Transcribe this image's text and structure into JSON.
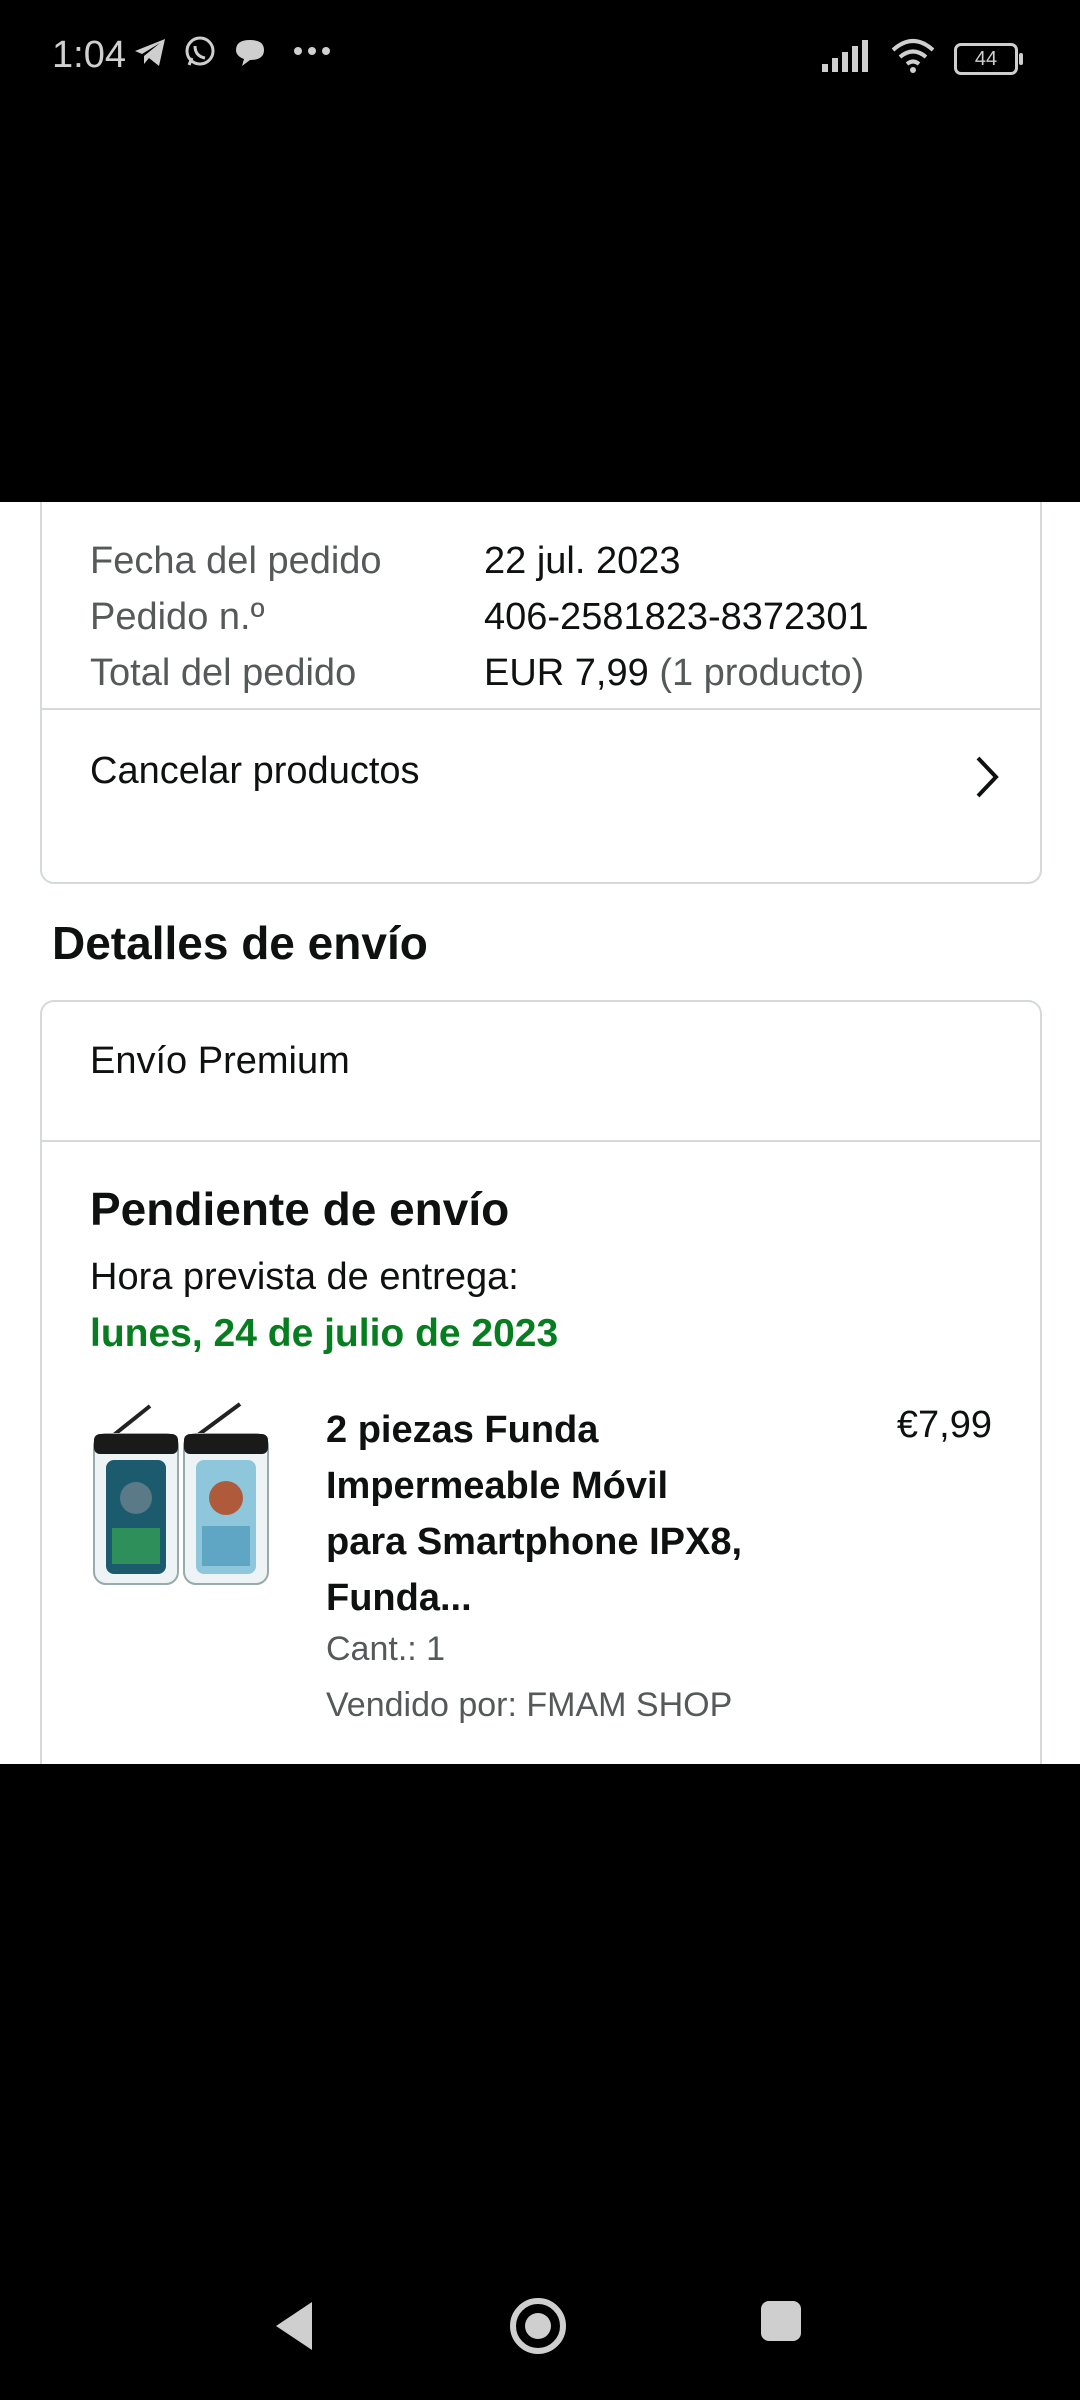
{
  "status_bar": {
    "time": "1:04",
    "battery": "44",
    "icons": [
      "telegram-icon",
      "whatsapp-icon",
      "chat-bubble-icon",
      "more-dots-icon",
      "signal-icon",
      "wifi-icon",
      "battery-icon"
    ]
  },
  "order_summary": {
    "rows": [
      {
        "label": "Fecha del pedido",
        "value": "22 jul. 2023"
      },
      {
        "label": "Pedido n.º",
        "value": "406-2581823-8372301"
      },
      {
        "label": "Total del pedido",
        "value": "EUR 7,99",
        "extra": "(1 producto)"
      }
    ],
    "cancel_label": "Cancelar productos"
  },
  "shipping": {
    "section_title": "Detalles de envío",
    "type": "Envío Premium",
    "status": "Pendiente de envío",
    "eta_label": "Hora prevista de entrega:",
    "eta_date": "lunes, 24 de julio de 2023",
    "product": {
      "title": "2 piezas Funda Impermeable Móvil para Smartphone IPX8, Funda...",
      "price": "€7,99",
      "qty": "Cant.: 1",
      "seller": "Vendido por: FMAM SHOP"
    }
  },
  "colors": {
    "eta_green": "#067d1f",
    "border": "#d5d9d9",
    "muted_text": "#565959"
  }
}
